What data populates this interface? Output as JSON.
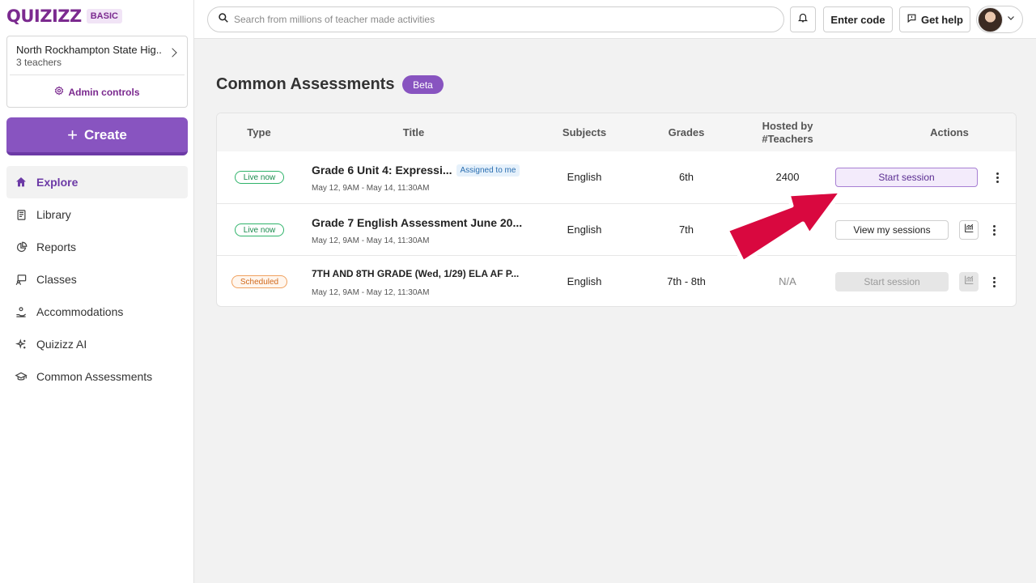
{
  "brand": {
    "logo": "QUIZIZZ",
    "plan": "BASIC"
  },
  "org": {
    "name": "North Rockhampton State Hig...",
    "teachers": "3 teachers",
    "admin_label": "Admin controls"
  },
  "create_label": "Create",
  "nav": [
    {
      "label": "Explore",
      "icon": "home-icon",
      "active": true
    },
    {
      "label": "Library",
      "icon": "book-icon"
    },
    {
      "label": "Reports",
      "icon": "pie-chart-icon"
    },
    {
      "label": "Classes",
      "icon": "classroom-icon"
    },
    {
      "label": "Accommodations",
      "icon": "hand-heart-icon"
    },
    {
      "label": "Quizizz AI",
      "icon": "sparkle-icon"
    },
    {
      "label": "Common Assessments",
      "icon": "graduation-cap-icon"
    }
  ],
  "topbar": {
    "search_placeholder": "Search from millions of teacher made activities",
    "enter_code": "Enter code",
    "get_help": "Get help"
  },
  "page": {
    "title": "Common Assessments",
    "badge": "Beta"
  },
  "table": {
    "headers": {
      "type": "Type",
      "title": "Title",
      "subjects": "Subjects",
      "grades": "Grades",
      "hosted_line1": "Hosted by",
      "hosted_line2": "#Teachers",
      "actions": "Actions"
    },
    "rows": [
      {
        "status": "Live now",
        "title": "Grade 6 Unit 4: Expressi...",
        "tag": "Assigned to me",
        "date": "May 12, 9AM - May 14, 11:30AM",
        "subject": "English",
        "grade": "6th",
        "hosted": "2400",
        "action": "Start session"
      },
      {
        "status": "Live now",
        "title": "Grade 7 English Assessment June 20...",
        "date": "May 12, 9AM - May 14, 11:30AM",
        "subject": "English",
        "grade": "7th",
        "hosted": "",
        "action": "View my sessions"
      },
      {
        "status": "Scheduled",
        "title": "7TH AND 8TH GRADE (Wed, 1/29) ELA AF P...",
        "date": "May 12, 9AM - May 12, 11:30AM",
        "subject": "English",
        "grade": "7th - 8th",
        "hosted": "N/A",
        "action": "Start session"
      }
    ]
  },
  "colors": {
    "brand_purple": "#8854c0",
    "arrow_red": "#d9083f"
  }
}
